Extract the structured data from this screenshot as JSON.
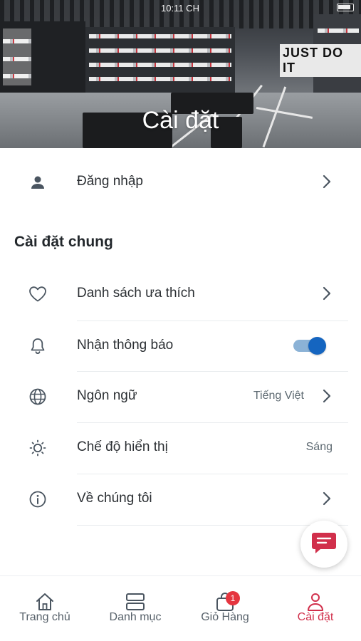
{
  "status_bar": {
    "time": "10:11 CH"
  },
  "header": {
    "title": "Cài đặt",
    "background": "store-photo",
    "store_sign": "JUST DO IT"
  },
  "login_row": {
    "label": "Đăng nhập",
    "icon": "person-icon"
  },
  "general_section": {
    "title": "Cài đặt chung",
    "items": [
      {
        "label": "Danh sách ưa thích",
        "icon": "heart-icon",
        "value": "",
        "control": "chevron"
      },
      {
        "label": "Nhận thông báo",
        "icon": "bell-icon",
        "value": "",
        "control": "toggle",
        "enabled": true
      },
      {
        "label": "Ngôn ngữ",
        "icon": "globe-icon",
        "value": "Tiếng Việt",
        "control": "chevron"
      },
      {
        "label": "Chế độ hiển thị",
        "icon": "sun-icon",
        "value": "Sáng",
        "control": "none"
      },
      {
        "label": "Về chúng tôi",
        "icon": "info-icon",
        "value": "",
        "control": "chevron"
      }
    ]
  },
  "chat_button": {
    "icon": "chat-icon"
  },
  "bottom_nav": {
    "items": [
      {
        "label": "Trang chủ",
        "icon": "home-icon",
        "active": false
      },
      {
        "label": "Danh mục",
        "icon": "category-icon",
        "active": false
      },
      {
        "label": "Giỏ Hàng",
        "icon": "cart-bag-icon",
        "active": false,
        "badge": "1"
      },
      {
        "label": "Cài đặt",
        "icon": "settings-person-icon",
        "active": true
      }
    ]
  },
  "colors": {
    "accent": "#d12f4b",
    "toggle_on": "#1565c0",
    "badge": "#e5353f",
    "text": "#2b2f33",
    "muted": "#5e6a72"
  }
}
